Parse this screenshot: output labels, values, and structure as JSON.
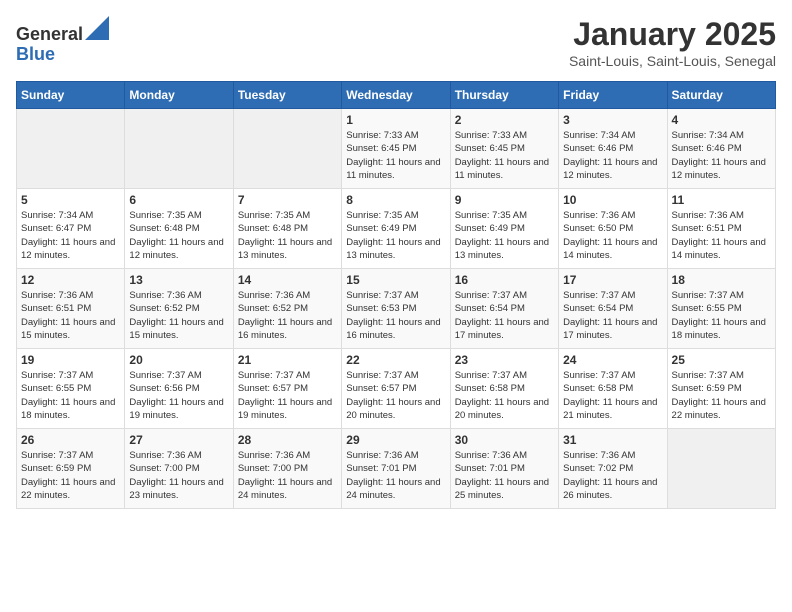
{
  "header": {
    "logo_general": "General",
    "logo_blue": "Blue",
    "month_title": "January 2025",
    "location": "Saint-Louis, Saint-Louis, Senegal"
  },
  "days_of_week": [
    "Sunday",
    "Monday",
    "Tuesday",
    "Wednesday",
    "Thursday",
    "Friday",
    "Saturday"
  ],
  "weeks": [
    [
      {
        "day": "",
        "empty": true
      },
      {
        "day": "",
        "empty": true
      },
      {
        "day": "",
        "empty": true
      },
      {
        "day": "1",
        "sunrise": "7:33 AM",
        "sunset": "6:45 PM",
        "daylight": "11 hours and 11 minutes."
      },
      {
        "day": "2",
        "sunrise": "7:33 AM",
        "sunset": "6:45 PM",
        "daylight": "11 hours and 11 minutes."
      },
      {
        "day": "3",
        "sunrise": "7:34 AM",
        "sunset": "6:46 PM",
        "daylight": "11 hours and 12 minutes."
      },
      {
        "day": "4",
        "sunrise": "7:34 AM",
        "sunset": "6:46 PM",
        "daylight": "11 hours and 12 minutes."
      }
    ],
    [
      {
        "day": "5",
        "sunrise": "7:34 AM",
        "sunset": "6:47 PM",
        "daylight": "11 hours and 12 minutes."
      },
      {
        "day": "6",
        "sunrise": "7:35 AM",
        "sunset": "6:48 PM",
        "daylight": "11 hours and 12 minutes."
      },
      {
        "day": "7",
        "sunrise": "7:35 AM",
        "sunset": "6:48 PM",
        "daylight": "11 hours and 13 minutes."
      },
      {
        "day": "8",
        "sunrise": "7:35 AM",
        "sunset": "6:49 PM",
        "daylight": "11 hours and 13 minutes."
      },
      {
        "day": "9",
        "sunrise": "7:35 AM",
        "sunset": "6:49 PM",
        "daylight": "11 hours and 13 minutes."
      },
      {
        "day": "10",
        "sunrise": "7:36 AM",
        "sunset": "6:50 PM",
        "daylight": "11 hours and 14 minutes."
      },
      {
        "day": "11",
        "sunrise": "7:36 AM",
        "sunset": "6:51 PM",
        "daylight": "11 hours and 14 minutes."
      }
    ],
    [
      {
        "day": "12",
        "sunrise": "7:36 AM",
        "sunset": "6:51 PM",
        "daylight": "11 hours and 15 minutes."
      },
      {
        "day": "13",
        "sunrise": "7:36 AM",
        "sunset": "6:52 PM",
        "daylight": "11 hours and 15 minutes."
      },
      {
        "day": "14",
        "sunrise": "7:36 AM",
        "sunset": "6:52 PM",
        "daylight": "11 hours and 16 minutes."
      },
      {
        "day": "15",
        "sunrise": "7:37 AM",
        "sunset": "6:53 PM",
        "daylight": "11 hours and 16 minutes."
      },
      {
        "day": "16",
        "sunrise": "7:37 AM",
        "sunset": "6:54 PM",
        "daylight": "11 hours and 17 minutes."
      },
      {
        "day": "17",
        "sunrise": "7:37 AM",
        "sunset": "6:54 PM",
        "daylight": "11 hours and 17 minutes."
      },
      {
        "day": "18",
        "sunrise": "7:37 AM",
        "sunset": "6:55 PM",
        "daylight": "11 hours and 18 minutes."
      }
    ],
    [
      {
        "day": "19",
        "sunrise": "7:37 AM",
        "sunset": "6:55 PM",
        "daylight": "11 hours and 18 minutes."
      },
      {
        "day": "20",
        "sunrise": "7:37 AM",
        "sunset": "6:56 PM",
        "daylight": "11 hours and 19 minutes."
      },
      {
        "day": "21",
        "sunrise": "7:37 AM",
        "sunset": "6:57 PM",
        "daylight": "11 hours and 19 minutes."
      },
      {
        "day": "22",
        "sunrise": "7:37 AM",
        "sunset": "6:57 PM",
        "daylight": "11 hours and 20 minutes."
      },
      {
        "day": "23",
        "sunrise": "7:37 AM",
        "sunset": "6:58 PM",
        "daylight": "11 hours and 20 minutes."
      },
      {
        "day": "24",
        "sunrise": "7:37 AM",
        "sunset": "6:58 PM",
        "daylight": "11 hours and 21 minutes."
      },
      {
        "day": "25",
        "sunrise": "7:37 AM",
        "sunset": "6:59 PM",
        "daylight": "11 hours and 22 minutes."
      }
    ],
    [
      {
        "day": "26",
        "sunrise": "7:37 AM",
        "sunset": "6:59 PM",
        "daylight": "11 hours and 22 minutes."
      },
      {
        "day": "27",
        "sunrise": "7:36 AM",
        "sunset": "7:00 PM",
        "daylight": "11 hours and 23 minutes."
      },
      {
        "day": "28",
        "sunrise": "7:36 AM",
        "sunset": "7:00 PM",
        "daylight": "11 hours and 24 minutes."
      },
      {
        "day": "29",
        "sunrise": "7:36 AM",
        "sunset": "7:01 PM",
        "daylight": "11 hours and 24 minutes."
      },
      {
        "day": "30",
        "sunrise": "7:36 AM",
        "sunset": "7:01 PM",
        "daylight": "11 hours and 25 minutes."
      },
      {
        "day": "31",
        "sunrise": "7:36 AM",
        "sunset": "7:02 PM",
        "daylight": "11 hours and 26 minutes."
      },
      {
        "day": "",
        "empty": true
      }
    ]
  ],
  "labels": {
    "sunrise": "Sunrise:",
    "sunset": "Sunset:",
    "daylight": "Daylight:"
  }
}
